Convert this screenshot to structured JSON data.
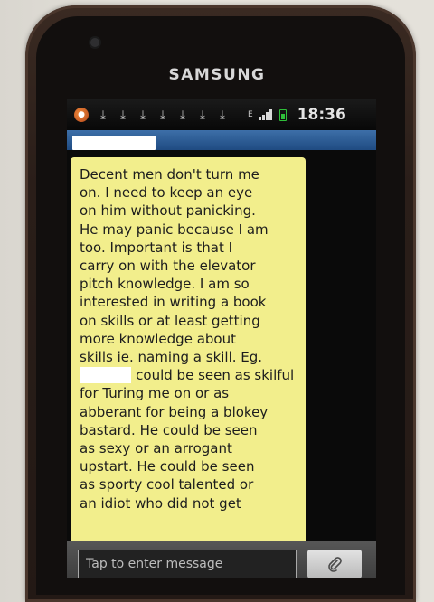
{
  "device": {
    "brand": "SAMSUNG"
  },
  "status_bar": {
    "time": "18:36",
    "network": "E",
    "icons": [
      "app-notification-icon",
      "download-icon",
      "download-icon",
      "download-icon",
      "download-icon",
      "download-icon",
      "download-icon",
      "download-icon",
      "signal-icon",
      "battery-icon"
    ]
  },
  "conversation": {
    "contact_name": ""
  },
  "message": {
    "lines": [
      "Decent men don't turn me",
      "on. I need to keep an eye",
      "on him without panicking.",
      "He may panic because I am",
      "too. Important is that I",
      "carry on with the elevator",
      "pitch knowledge. I am so",
      "interested in writing a book",
      "on skills or at least getting",
      "more knowledge about",
      "skills ie. naming a skill. Eg.",
      "could be seen as skilful",
      "for Turing me on or as",
      "abberant for being a blokey",
      "bastard. He could be seen",
      "as sexy or an arrogant",
      "upstart. He could be seen",
      "as sporty cool talented or",
      "an idiot who did not get"
    ],
    "bubble_color": "#f2ee8c"
  },
  "composer": {
    "placeholder": "Tap to enter message",
    "value": ""
  },
  "colors": {
    "title_bar": "#2c5d97",
    "battery": "#2fbf3a"
  }
}
